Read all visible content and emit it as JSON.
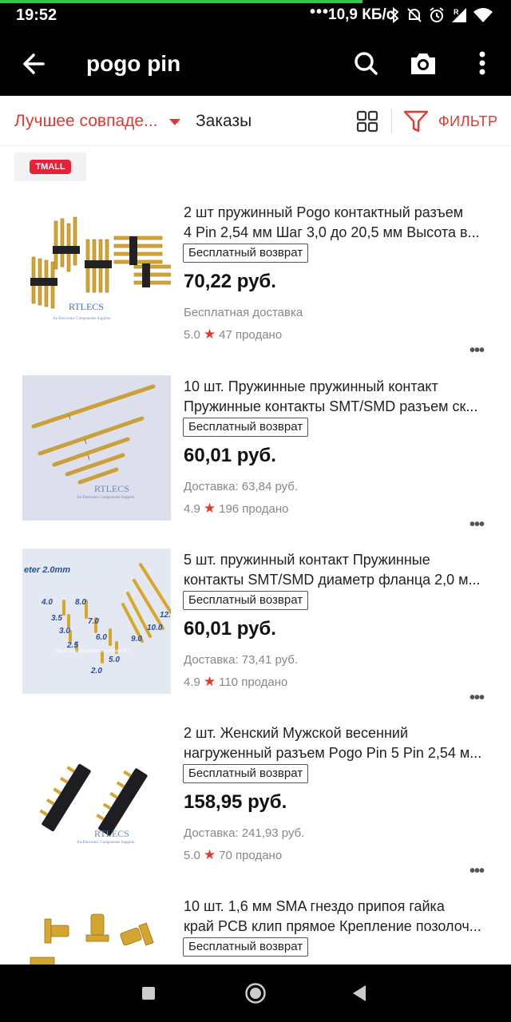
{
  "status_bar": {
    "time": "19:52",
    "dots": "•••",
    "network_speed": "10,9 КБ/с",
    "download_progress": 0.71
  },
  "app_bar": {
    "query": "pogo pin",
    "icons": [
      "back-arrow-icon",
      "search-icon",
      "camera-icon",
      "more-vertical-icon"
    ]
  },
  "sort_bar": {
    "best_match": "Лучшее совпаде...",
    "orders": "Заказы",
    "filter": "ФИЛЬТР",
    "accent_color": "#e23a2e"
  },
  "tmall_chip": {
    "logo_text": "TMALL"
  },
  "products": [
    {
      "title_line1": "2 шт пружинный Pogo контактный разъем",
      "title_line2": "4 Pin 2,54 мм Шаг 3,0 до 20,5 мм Высота в...",
      "badge": "Бесплатный возврат",
      "price": "70,22 руб.",
      "delivery": "Бесплатная доставка",
      "rating": "5.0",
      "sold": "47 продано",
      "image_caption": "RTLECS",
      "image_subcaption": "An Electronic Components Supplier"
    },
    {
      "title_line1": "10 шт. Пружинные пружинный контакт",
      "title_line2": "Пружинные контакты SMT/SMD разъем ск...",
      "badge": "Бесплатный возврат",
      "price": "60,01 руб.",
      "delivery": "Доставка: 63,84 руб.",
      "rating": "4.9",
      "sold": "196 продано",
      "image_caption": "RTLECS",
      "image_subcaption": "An Electronic Components Supplier"
    },
    {
      "title_line1": "5 шт. пружинный контакт Пружинные",
      "title_line2": "контакты SMT/SMD диаметр фланца 2,0 м...",
      "badge": "Бесплатный возврат",
      "price": "60,01 руб.",
      "delivery": "Доставка: 73,41 руб.",
      "rating": "4.9",
      "sold": "110 продано",
      "image_caption": "eter 2.0mm",
      "image_subcaption": "http://www.aliexpress.com/store/900"
    },
    {
      "title_line1": "2 шт. Женский Мужской весенний",
      "title_line2": "нагруженный разъем Pogo Pin 5 Pin 2,54 м...",
      "badge": "Бесплатный возврат",
      "price": "158,95 руб.",
      "delivery": "Доставка: 241,93 руб.",
      "rating": "5.0",
      "sold": "70 продано",
      "image_caption": "RTLECS",
      "image_subcaption": "An Electronic Components Supplier"
    },
    {
      "title_line1": "10 шт. 1,6 мм SMA гнездо припоя гайка",
      "title_line2": "край PCB клип прямое Крепление позолоч...",
      "badge": "Бесплатный возврат",
      "price": "",
      "delivery": "",
      "rating": "",
      "sold": "",
      "image_caption": "",
      "image_subcaption": ""
    }
  ],
  "more_dots": "•••",
  "star_glyph": "★",
  "pin_labels": [
    "4.0",
    "8.0",
    "3.5",
    "7.0",
    "3.0",
    "6.0",
    "2.5",
    "5.0",
    "2.0",
    "9.0",
    "10.0",
    "12."
  ],
  "nav_bar": {
    "icons": [
      "recents-square-icon",
      "home-circle-icon",
      "back-triangle-icon"
    ]
  }
}
